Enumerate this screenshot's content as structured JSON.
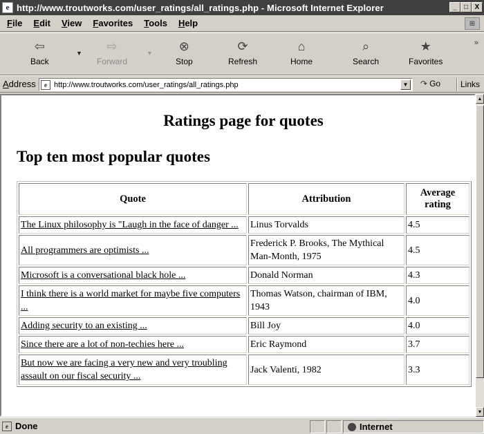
{
  "window": {
    "title": "http://www.troutworks.com/user_ratings/all_ratings.php - Microsoft Internet Explorer",
    "minimize": "_",
    "maximize": "□",
    "close": "X"
  },
  "menu": [
    "File",
    "Edit",
    "View",
    "Favorites",
    "Tools",
    "Help"
  ],
  "toolbar": {
    "back": "Back",
    "forward": "Forward",
    "stop": "Stop",
    "refresh": "Refresh",
    "home": "Home",
    "search": "Search",
    "favorites": "Favorites"
  },
  "address": {
    "label": "Address",
    "url": "http://www.troutworks.com/user_ratings/all_ratings.php",
    "go": "Go",
    "links": "Links"
  },
  "page": {
    "heading": "Ratings page for quotes",
    "section": "Top ten most popular quotes",
    "columns": [
      "Quote",
      "Attribution",
      "Average rating"
    ],
    "rows": [
      {
        "quote": "The Linux philosophy is \"Laugh in the face of danger ...",
        "attribution": "Linus Torvalds",
        "rating": "4.5"
      },
      {
        "quote": "All programmers are optimists ...",
        "attribution": "Frederick P. Brooks, The Mythical Man-Month, 1975",
        "rating": "4.5"
      },
      {
        "quote": "Microsoft is a conversational black hole ...",
        "attribution": "Donald Norman",
        "rating": "4.3"
      },
      {
        "quote": "I think there is a world market for maybe five computers ...",
        "attribution": "Thomas Watson, chairman of IBM, 1943",
        "rating": "4.0"
      },
      {
        "quote": "Adding security to an existing ...",
        "attribution": "Bill Joy",
        "rating": "4.0"
      },
      {
        "quote": "Since there are a lot of non-techies here ...",
        "attribution": "Eric Raymond",
        "rating": "3.7"
      },
      {
        "quote": "But now we are facing a very new and very troubling assault on our fiscal security ...",
        "attribution": "Jack Valenti, 1982",
        "rating": "3.3"
      }
    ]
  },
  "status": {
    "text": "Done",
    "zone": "Internet"
  }
}
